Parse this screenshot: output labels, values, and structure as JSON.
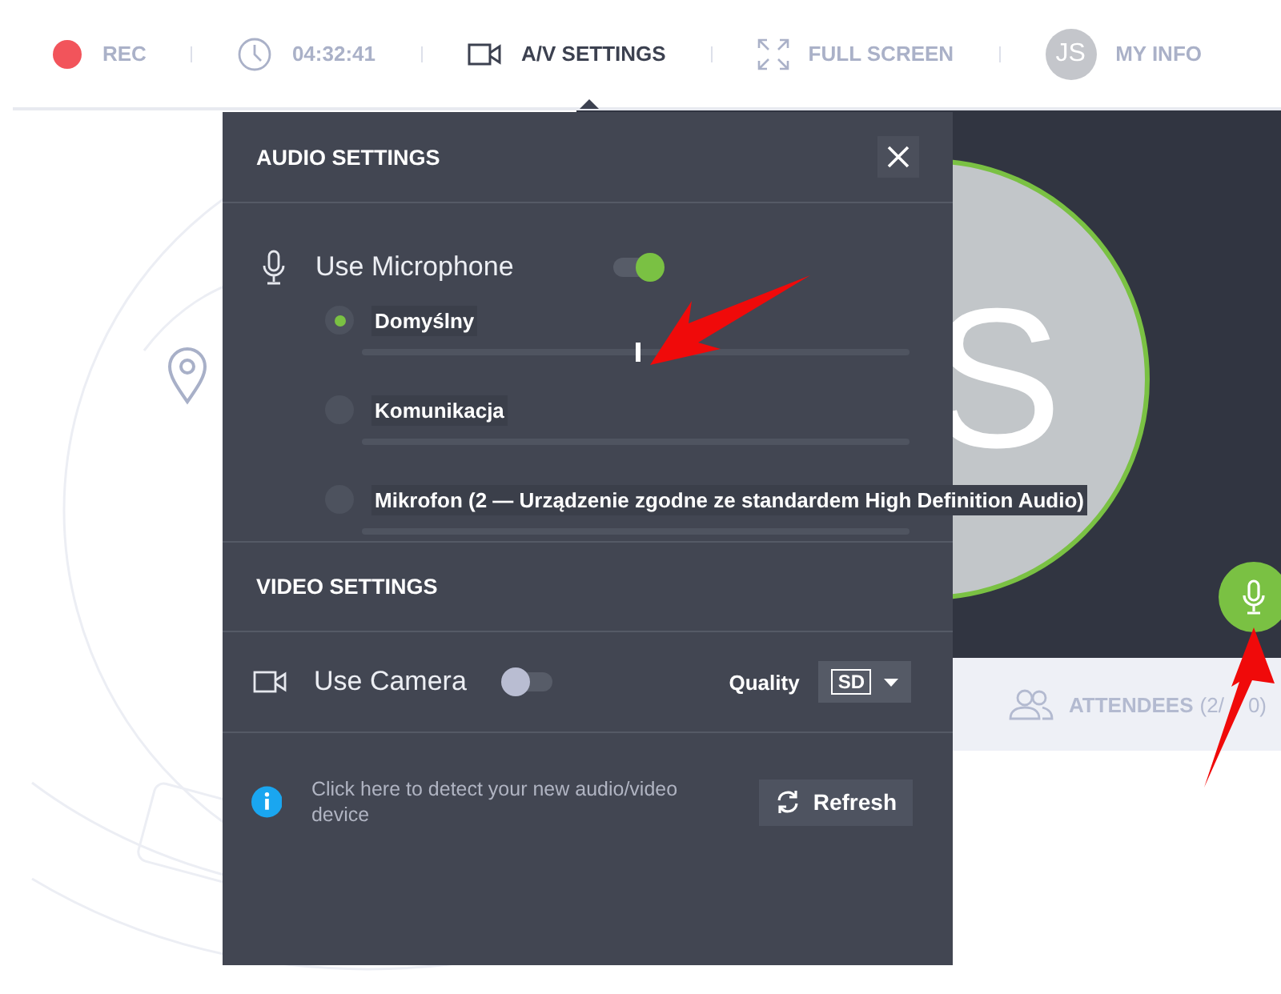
{
  "topbar": {
    "items": [
      {
        "kind": "rec",
        "label": "REC",
        "selected": false
      },
      {
        "kind": "timer",
        "label": "04:32:41",
        "selected": false
      },
      {
        "kind": "av",
        "label": "A/V SETTINGS",
        "selected": true
      },
      {
        "kind": "fullscreen",
        "label": "FULL SCREEN",
        "selected": false
      },
      {
        "kind": "profile",
        "avatar": "JS",
        "label": "MY INFO",
        "selected": false
      }
    ]
  },
  "video": {
    "avatar_letter": "S",
    "mic_on": true
  },
  "attendees_tab": {
    "label": "ATTENDEES",
    "count_parts": [
      "(2/",
      "0)"
    ]
  },
  "dialog": {
    "audio": {
      "title": "AUDIO SETTINGS",
      "use_microphone": {
        "label": "Use Microphone",
        "on": true
      },
      "devices": [
        {
          "name": "Domyślny",
          "selected": true,
          "level": 0.5
        },
        {
          "name": "Komunikacja",
          "selected": false
        },
        {
          "name": "Mikrofon (2 — Urządzenie zgodne ze standardem High Definition Audio)",
          "selected": false
        }
      ]
    },
    "video": {
      "title": "VIDEO SETTINGS",
      "use_camera": {
        "label": "Use Camera",
        "on": false
      },
      "quality_label": "Quality",
      "quality": "SD"
    },
    "hint": "Click here to detect your new audio/video device",
    "refresh": "Refresh"
  }
}
